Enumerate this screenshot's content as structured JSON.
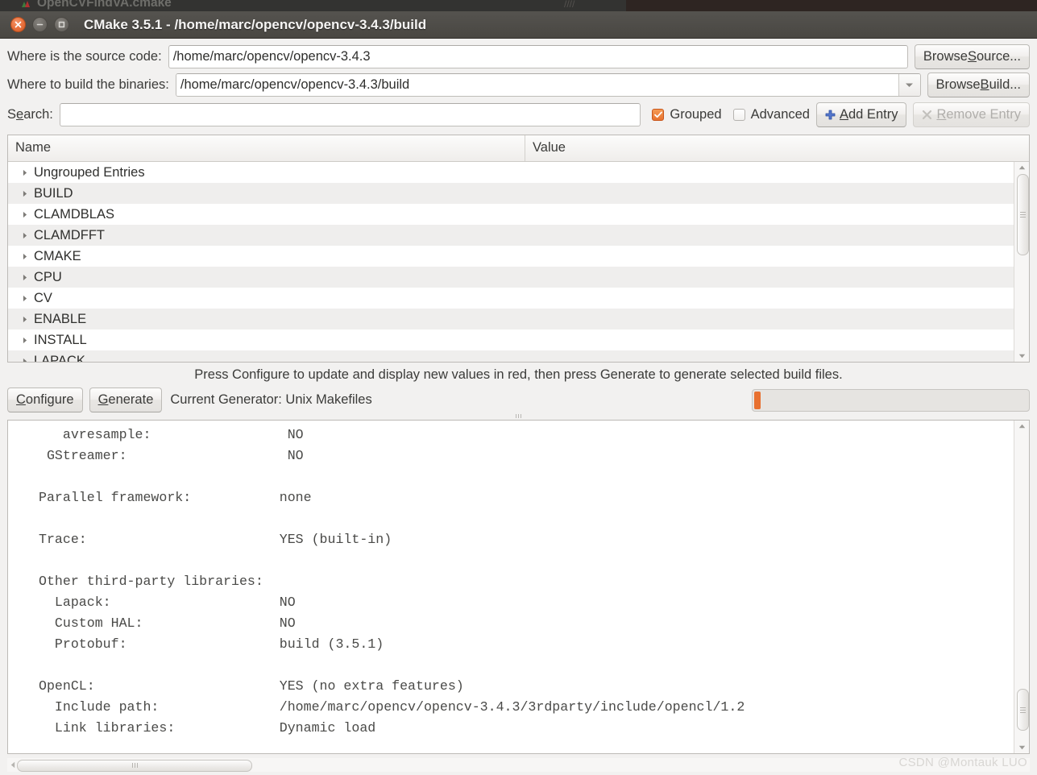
{
  "background_window": {
    "title": "OpenCVFindVA.cmake"
  },
  "window": {
    "title": "CMake 3.5.1 - /home/marc/opencv/opencv-3.4.3/build",
    "close_icon": "close-icon",
    "minimize_icon": "minimize-icon",
    "maximize_icon": "maximize-icon"
  },
  "form": {
    "source_label_pre": "Where is the source code:",
    "source_value": "/home/marc/opencv/opencv-3.4.3",
    "browse_source_pre": "Browse ",
    "browse_source_mnemonic": "S",
    "browse_source_post": "ource...",
    "build_label": "Where to build the binaries:",
    "build_value": "/home/marc/opencv/opencv-3.4.3/build",
    "browse_build_pre": "Browse ",
    "browse_build_mnemonic": "B",
    "browse_build_post": "uild...",
    "search_label_pre": "S",
    "search_label_mnemonic": "e",
    "search_label_post": "arch:",
    "search_value": "",
    "search_placeholder": "",
    "grouped_label": "Grouped",
    "grouped_checked": true,
    "advanced_label": "Advanced",
    "advanced_checked": false,
    "add_entry_pre": "",
    "add_entry_mnemonic": "A",
    "add_entry_post": "dd Entry",
    "add_entry_icon": "plus-icon",
    "remove_entry_pre": "",
    "remove_entry_mnemonic": "R",
    "remove_entry_post": "emove Entry",
    "remove_entry_icon": "x-icon",
    "remove_entry_disabled": true
  },
  "cache_tree": {
    "columns": [
      "Name",
      "Value"
    ],
    "rows": [
      {
        "name": "Ungrouped Entries",
        "value": "",
        "expandable": true
      },
      {
        "name": "BUILD",
        "value": "",
        "expandable": true
      },
      {
        "name": "CLAMDBLAS",
        "value": "",
        "expandable": true
      },
      {
        "name": "CLAMDFFT",
        "value": "",
        "expandable": true
      },
      {
        "name": "CMAKE",
        "value": "",
        "expandable": true
      },
      {
        "name": "CPU",
        "value": "",
        "expandable": true
      },
      {
        "name": "CV",
        "value": "",
        "expandable": true
      },
      {
        "name": "ENABLE",
        "value": "",
        "expandable": true
      },
      {
        "name": "INSTALL",
        "value": "",
        "expandable": true
      },
      {
        "name": "LAPACK",
        "value": "",
        "expandable": true
      }
    ],
    "scroll_thumb_percent": 45
  },
  "hint": "Press Configure to update and display new values in red, then press Generate to generate selected build files.",
  "actions": {
    "configure_mnemonic": "C",
    "configure_post": "onfigure",
    "generate_mnemonic": "G",
    "generate_post": "enerate",
    "generator_label": "Current Generator: Unix Makefiles",
    "progress_percent": 2,
    "progress_color": "#e8702f"
  },
  "log": {
    "text": "   avresample:                 NO\n GStreamer:                    NO\n\nParallel framework:           none\n\nTrace:                        YES (built-in)\n\nOther third-party libraries:\n  Lapack:                     NO\n  Custom HAL:                 NO\n  Protobuf:                   build (3.5.1)\n\nOpenCL:                       YES (no extra features)\n  Include path:               /home/marc/opencv/opencv-3.4.3/3rdparty/include/opencl/1.2\n  Link libraries:             Dynamic load"
  },
  "statusbar": {
    "watermark": "CSDN @Montauk LUO"
  }
}
